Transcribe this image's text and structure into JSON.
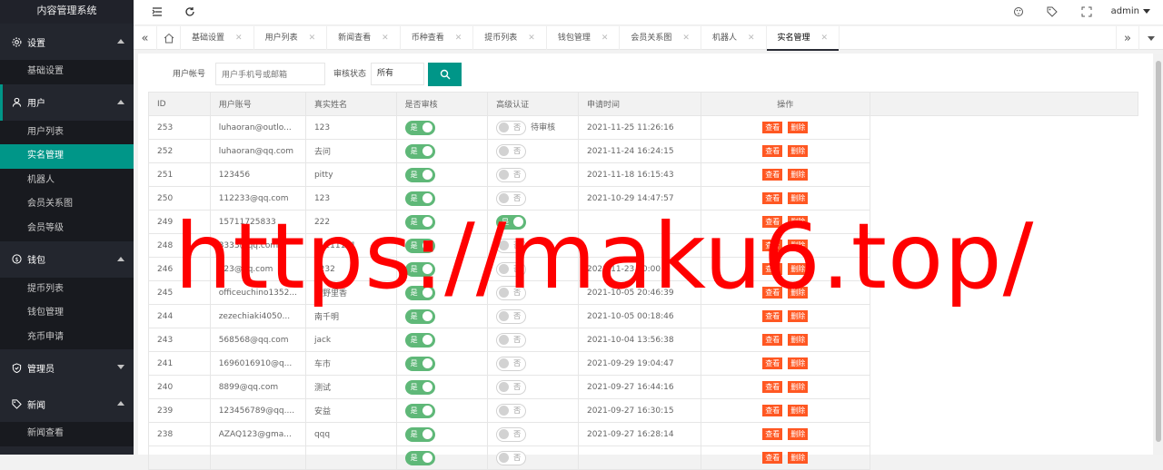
{
  "sidebar": {
    "title": "内容管理系统",
    "groups": [
      {
        "label": "设置",
        "icon": "gear-icon",
        "expanded": true,
        "items": [
          "基础设置"
        ]
      },
      {
        "label": "用户",
        "icon": "user-icon",
        "expanded": true,
        "items": [
          "用户列表",
          "实名管理",
          "机器人",
          "会员关系图",
          "会员等级"
        ]
      },
      {
        "label": "钱包",
        "icon": "dollar-icon",
        "expanded": true,
        "items": [
          "提币列表",
          "钱包管理",
          "充币申请"
        ]
      },
      {
        "label": "管理员",
        "icon": "shield-icon",
        "expanded": false,
        "items": []
      },
      {
        "label": "新闻",
        "icon": "tag-icon",
        "expanded": true,
        "items": [
          "新闻查看"
        ]
      }
    ],
    "active_item": "实名管理"
  },
  "topbar": {
    "user": "admin",
    "icons": [
      "menu-fold-icon",
      "refresh-icon",
      "theme-icon",
      "tag-icon",
      "fullscreen-icon"
    ]
  },
  "tabs": [
    "基础设置",
    "用户列表",
    "新闻查看",
    "币种查看",
    "提币列表",
    "钱包管理",
    "会员关系图",
    "机器人",
    "实名管理"
  ],
  "active_tab": "实名管理",
  "search": {
    "account_label": "用户帐号",
    "account_placeholder": "用户手机号或邮箱",
    "status_label": "审核状态",
    "status_value": "所有"
  },
  "table": {
    "headers": [
      "ID",
      "用户账号",
      "真实姓名",
      "是否审核",
      "高级认证",
      "申请时间",
      "操作"
    ],
    "switch_on": "是",
    "switch_off": "否",
    "view_label": "查看",
    "delete_label": "删除",
    "rows": [
      {
        "id": "253",
        "account": "luhaoran@outlo...",
        "name": "123",
        "audited": true,
        "advanced": false,
        "advanced_note": "待审核",
        "time": "2021-11-25 11:26:16"
      },
      {
        "id": "252",
        "account": "luhaoran@qq.com",
        "name": "去问",
        "audited": true,
        "advanced": false,
        "advanced_note": "",
        "time": "2021-11-24 16:24:15"
      },
      {
        "id": "251",
        "account": "123456",
        "name": "pitty",
        "audited": true,
        "advanced": false,
        "advanced_note": "",
        "time": "2021-11-18 16:15:43"
      },
      {
        "id": "250",
        "account": "112233@qq.com",
        "name": "123",
        "audited": true,
        "advanced": false,
        "advanced_note": "",
        "time": "2021-10-29 14:47:57"
      },
      {
        "id": "249",
        "account": "15711725833",
        "name": "222",
        "audited": true,
        "advanced": true,
        "advanced_note": "",
        "time": ""
      },
      {
        "id": "248",
        "account": "3333@qq.com",
        "name": "11111111",
        "audited": true,
        "advanced": false,
        "advanced_note": "",
        "time": ""
      },
      {
        "id": "246",
        "account": "123@qq.com",
        "name": "5232",
        "audited": true,
        "advanced": false,
        "advanced_note": "",
        "time": "2021-11-23 20:00"
      },
      {
        "id": "245",
        "account": "officeuchino1352...",
        "name": "内野里香",
        "audited": true,
        "advanced": false,
        "advanced_note": "",
        "time": "2021-10-05 20:46:39"
      },
      {
        "id": "244",
        "account": "zezechiaki4050...",
        "name": "南千明",
        "audited": true,
        "advanced": false,
        "advanced_note": "",
        "time": "2021-10-05 00:18:46"
      },
      {
        "id": "243",
        "account": "568568@qq.com",
        "name": "jack",
        "audited": true,
        "advanced": false,
        "advanced_note": "",
        "time": "2021-10-04 13:56:38"
      },
      {
        "id": "241",
        "account": "1696016910@q...",
        "name": "车市",
        "audited": true,
        "advanced": false,
        "advanced_note": "",
        "time": "2021-09-29 19:04:47"
      },
      {
        "id": "240",
        "account": "8899@qq.com",
        "name": "测试",
        "audited": true,
        "advanced": false,
        "advanced_note": "",
        "time": "2021-09-27 16:44:16"
      },
      {
        "id": "239",
        "account": "123456789@qq....",
        "name": "安益",
        "audited": true,
        "advanced": false,
        "advanced_note": "",
        "time": "2021-09-27 16:30:15"
      },
      {
        "id": "238",
        "account": "AZAQ123@gma...",
        "name": "qqq",
        "audited": true,
        "advanced": false,
        "advanced_note": "",
        "time": "2021-09-27 16:28:14"
      },
      {
        "id": "",
        "account": "",
        "name": "",
        "audited": true,
        "advanced": false,
        "advanced_note": "",
        "time": ""
      }
    ]
  },
  "watermark": "https://maku6.top/"
}
